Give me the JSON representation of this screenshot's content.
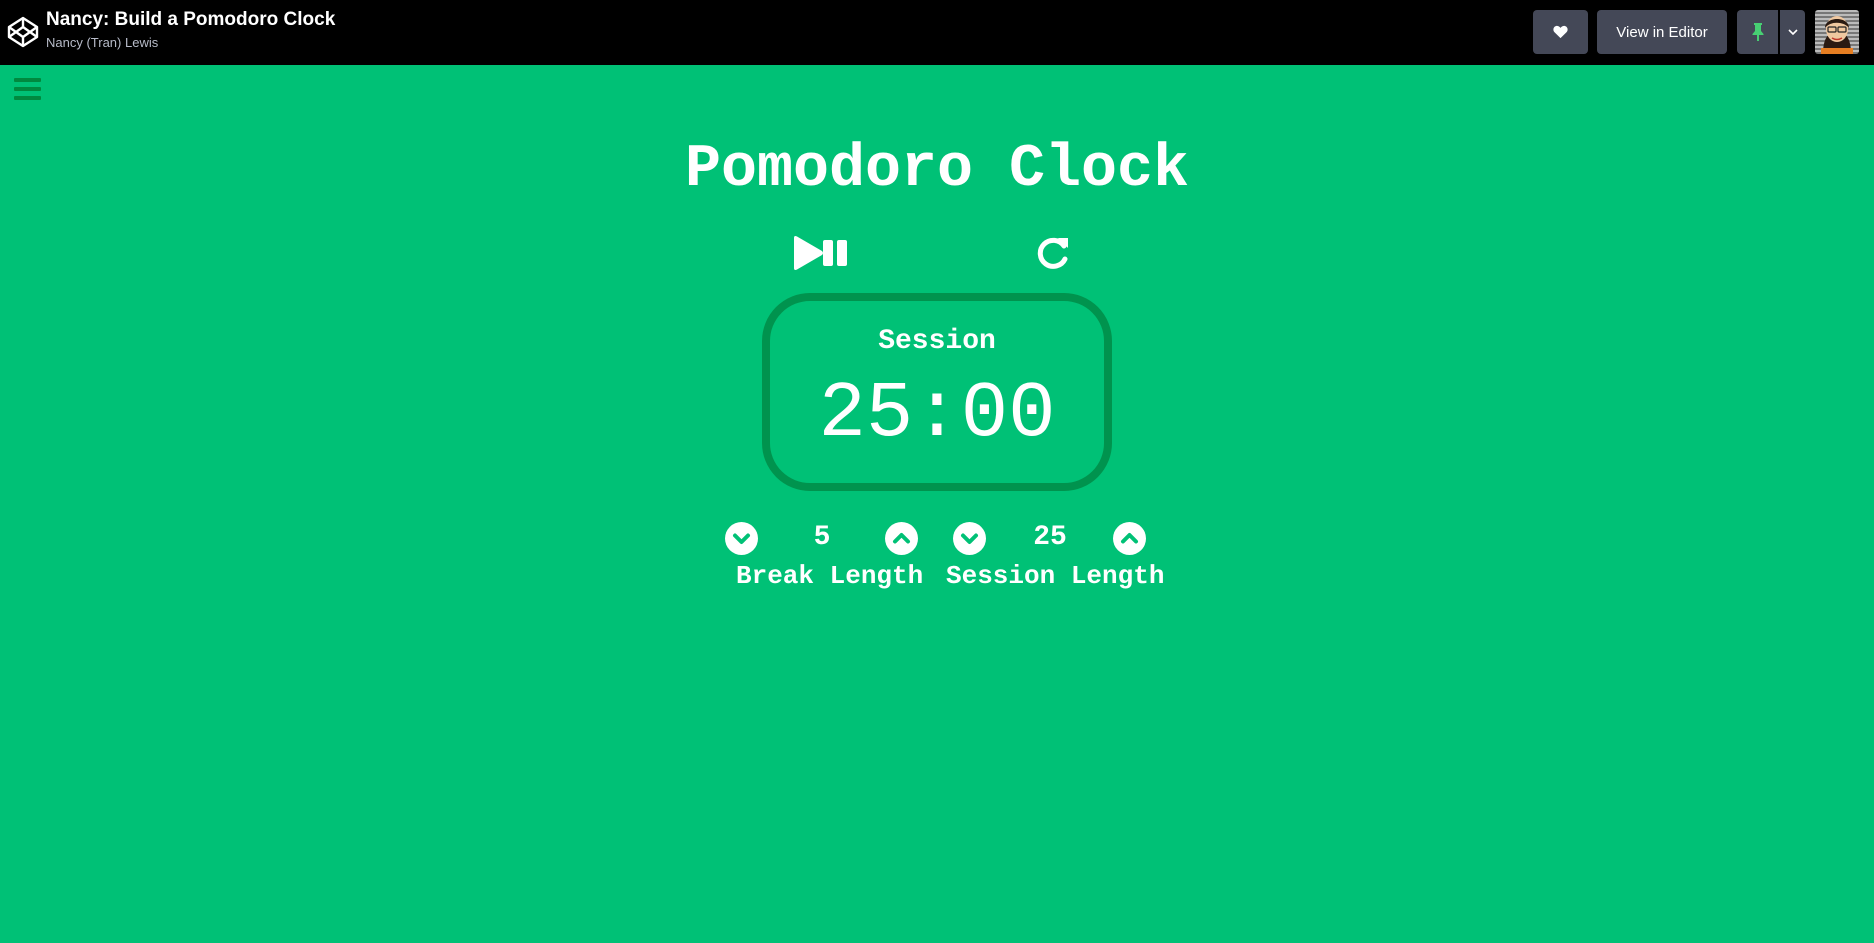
{
  "header": {
    "title": "Nancy: Build a Pomodoro Clock",
    "author": "Nancy (Tran) Lewis",
    "view_in_editor_label": "View in Editor",
    "icons": {
      "logo": "codepen-logo-icon",
      "heart": "heart-icon",
      "pin": "pin-icon",
      "caret": "chevron-down-icon"
    },
    "pin_color": "#47cf73"
  },
  "app": {
    "background": "#00c176",
    "title": "Pomodoro Clock",
    "timer": {
      "label": "Session",
      "value": "25:00",
      "border_color": "#00934e"
    },
    "controls": {
      "play_pause_icon": "play-pause-icon",
      "reset_icon": "refresh-icon"
    },
    "break": {
      "value": "5",
      "label": "Break Length"
    },
    "session": {
      "value": "25",
      "label": "Session Length"
    },
    "menu_icon": "hamburger-menu-icon"
  }
}
